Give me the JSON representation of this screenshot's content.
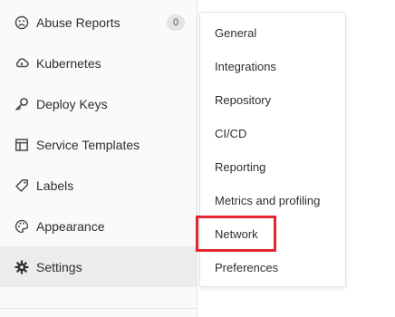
{
  "sidebar": {
    "items": [
      {
        "label": "Abuse Reports",
        "icon": "abuse-reports-icon",
        "badge": "0"
      },
      {
        "label": "Kubernetes",
        "icon": "kubernetes-icon"
      },
      {
        "label": "Deploy Keys",
        "icon": "key-icon"
      },
      {
        "label": "Service Templates",
        "icon": "service-templates-icon"
      },
      {
        "label": "Labels",
        "icon": "label-tag-icon"
      },
      {
        "label": "Appearance",
        "icon": "appearance-palette-icon"
      },
      {
        "label": "Settings",
        "icon": "gear-icon",
        "active": true
      }
    ]
  },
  "flyout": {
    "items": [
      {
        "label": "General"
      },
      {
        "label": "Integrations"
      },
      {
        "label": "Repository"
      },
      {
        "label": "CI/CD"
      },
      {
        "label": "Reporting"
      },
      {
        "label": "Metrics and profiling"
      },
      {
        "label": "Network",
        "highlighted": true
      },
      {
        "label": "Preferences"
      }
    ]
  },
  "colors": {
    "highlight": "#e3262f",
    "active_bg": "#ececec",
    "sidebar_bg": "#fafafa"
  }
}
